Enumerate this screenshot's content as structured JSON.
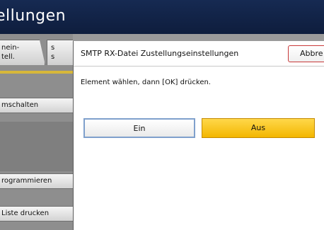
{
  "title": "ellungen",
  "tabs": [
    {
      "label_line1": "nein-",
      "label_line2": "tell."
    },
    {
      "label_line1": "s",
      "label_line2": "s"
    }
  ],
  "side_buttons": {
    "switch": "mschalten",
    "program": "rogrammieren",
    "print_list": "Liste drucken"
  },
  "dialog": {
    "title": "SMTP RX-Datei Zustellungseinstellungen",
    "abort_label": "Abbre",
    "instruction": "Element wählen, dann [OK] drücken.",
    "options": [
      {
        "label": "Ein",
        "selected": false
      },
      {
        "label": "Aus",
        "selected": true
      }
    ]
  },
  "colors": {
    "titlebar": "#162a52",
    "selected_option": "#f3b600",
    "abort_border": "#c9393a",
    "tab_underline": "#d7b73a"
  }
}
